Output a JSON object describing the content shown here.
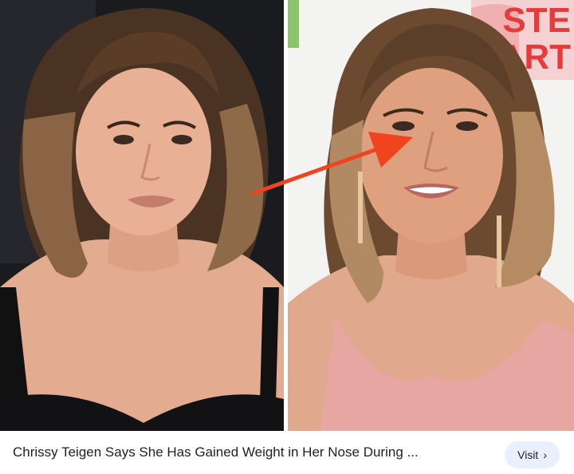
{
  "result": {
    "title": "Chrissy Teigen Says She Has Gained Weight in Her Nose During ...",
    "visit_label": "Visit",
    "visit_icon": "chevron-right-icon"
  },
  "images": {
    "left": {
      "subject": "woman-portrait-black-backdrop"
    },
    "right": {
      "subject": "woman-portrait-backdrop-logo"
    },
    "backdrop_logo_text": "STE ART"
  },
  "colors": {
    "arrow": "#f0441f",
    "visit_bg": "#e8f0fe",
    "title": "#202124"
  }
}
